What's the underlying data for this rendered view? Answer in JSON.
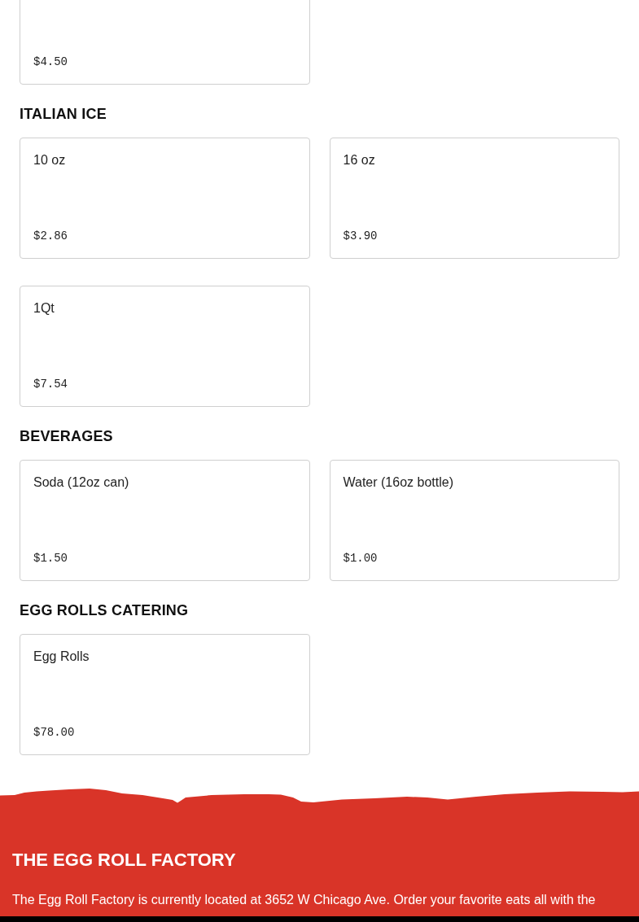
{
  "sections": [
    {
      "items": [
        {
          "price": "$4.50"
        }
      ]
    },
    {
      "heading": "ITALIAN ICE",
      "items": [
        {
          "name": "10 oz",
          "price": "$2.86"
        },
        {
          "name": "16 oz",
          "price": "$3.90"
        },
        {
          "name": "1Qt",
          "price": "$7.54"
        }
      ]
    },
    {
      "heading": "BEVERAGES",
      "items": [
        {
          "name": "Soda (12oz can)",
          "price": "$1.50"
        },
        {
          "name": "Water (16oz bottle)",
          "price": "$1.00"
        }
      ]
    },
    {
      "heading": "EGG ROLLS CATERING",
      "items": [
        {
          "name": "Egg Rolls",
          "price": "$78.00"
        }
      ]
    }
  ],
  "footer": {
    "title": "THE EGG ROLL FACTORY",
    "text": "The Egg Roll Factory is currently located at 3652 W Chicago Ave. Order your favorite eats all with the"
  }
}
